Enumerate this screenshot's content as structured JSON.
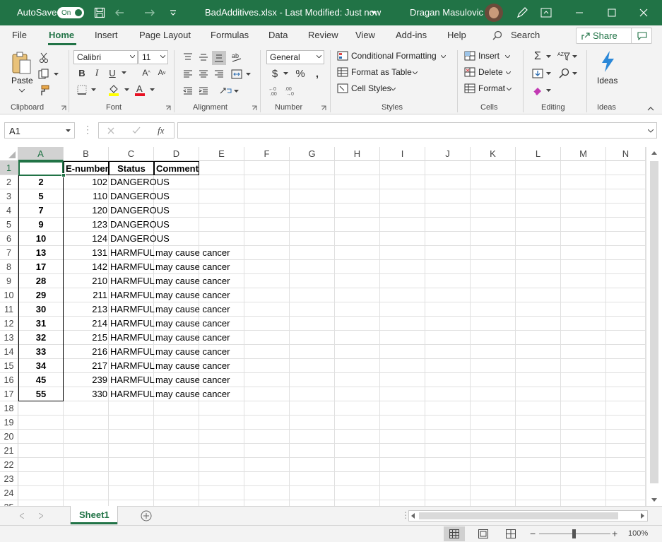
{
  "titlebar": {
    "autosave_label": "AutoSave",
    "autosave_state": "On",
    "doc_title": "BadAdditives.xlsx  -  Last Modified: Just now",
    "user_name": "Dragan Masulovic"
  },
  "tabs": [
    "File",
    "Home",
    "Insert",
    "Page Layout",
    "Formulas",
    "Data",
    "Review",
    "View",
    "Add-ins",
    "Help"
  ],
  "search_label": "Search",
  "share_label": "Share",
  "ribbon": {
    "clipboard": {
      "paste": "Paste",
      "label": "Clipboard"
    },
    "font": {
      "name": "Calibri",
      "size": "11",
      "label": "Font"
    },
    "alignment": {
      "label": "Alignment"
    },
    "number": {
      "format": "General",
      "label": "Number"
    },
    "styles": {
      "conditional": "Conditional Formatting",
      "table": "Format as Table",
      "cell_styles": "Cell Styles",
      "label": "Styles"
    },
    "cells": {
      "insert": "Insert",
      "delete": "Delete",
      "format": "Format",
      "label": "Cells"
    },
    "editing": {
      "label": "Editing"
    },
    "ideas": {
      "button": "Ideas",
      "label": "Ideas"
    }
  },
  "formula_bar": {
    "name_box": "A1",
    "fx": "fx",
    "content": ""
  },
  "columns": [
    "A",
    "B",
    "C",
    "D",
    "E",
    "F",
    "G",
    "H",
    "I",
    "J",
    "K",
    "L",
    "M",
    "N"
  ],
  "row_numbers": [
    "1",
    "2",
    "3",
    "4",
    "5",
    "6",
    "7",
    "8",
    "9",
    "10",
    "11",
    "12",
    "13",
    "14",
    "15",
    "16",
    "17",
    "18",
    "19",
    "20",
    "21",
    "22",
    "23",
    "24",
    "25"
  ],
  "header_row": {
    "a": "",
    "b": "E-number",
    "c": "Status",
    "d": "Comment"
  },
  "rows": [
    {
      "a": "2",
      "b": "102",
      "c": "DANGEROUS",
      "d": ""
    },
    {
      "a": "5",
      "b": "110",
      "c": "DANGEROUS",
      "d": ""
    },
    {
      "a": "7",
      "b": "120",
      "c": "DANGEROUS",
      "d": ""
    },
    {
      "a": "9",
      "b": "123",
      "c": "DANGEROUS",
      "d": ""
    },
    {
      "a": "10",
      "b": "124",
      "c": "DANGEROUS",
      "d": ""
    },
    {
      "a": "13",
      "b": "131",
      "c": "HARMFUL",
      "d": "may cause cancer"
    },
    {
      "a": "17",
      "b": "142",
      "c": "HARMFUL",
      "d": "may cause cancer"
    },
    {
      "a": "28",
      "b": "210",
      "c": "HARMFUL",
      "d": "may cause cancer"
    },
    {
      "a": "29",
      "b": "211",
      "c": "HARMFUL",
      "d": "may cause cancer"
    },
    {
      "a": "30",
      "b": "213",
      "c": "HARMFUL",
      "d": "may cause cancer"
    },
    {
      "a": "31",
      "b": "214",
      "c": "HARMFUL",
      "d": "may cause cancer"
    },
    {
      "a": "32",
      "b": "215",
      "c": "HARMFUL",
      "d": "may cause cancer"
    },
    {
      "a": "33",
      "b": "216",
      "c": "HARMFUL",
      "d": "may cause cancer"
    },
    {
      "a": "34",
      "b": "217",
      "c": "HARMFUL",
      "d": "may cause cancer"
    },
    {
      "a": "45",
      "b": "239",
      "c": "HARMFUL",
      "d": "may cause cancer"
    },
    {
      "a": "55",
      "b": "330",
      "c": "HARMFUL",
      "d": "may cause cancer"
    }
  ],
  "sheet_tab": "Sheet1",
  "zoom": "100%",
  "colors": {
    "accent": "#217346",
    "ribbon_bg": "#f3f3f3",
    "grid_line": "#e0e0e0"
  }
}
